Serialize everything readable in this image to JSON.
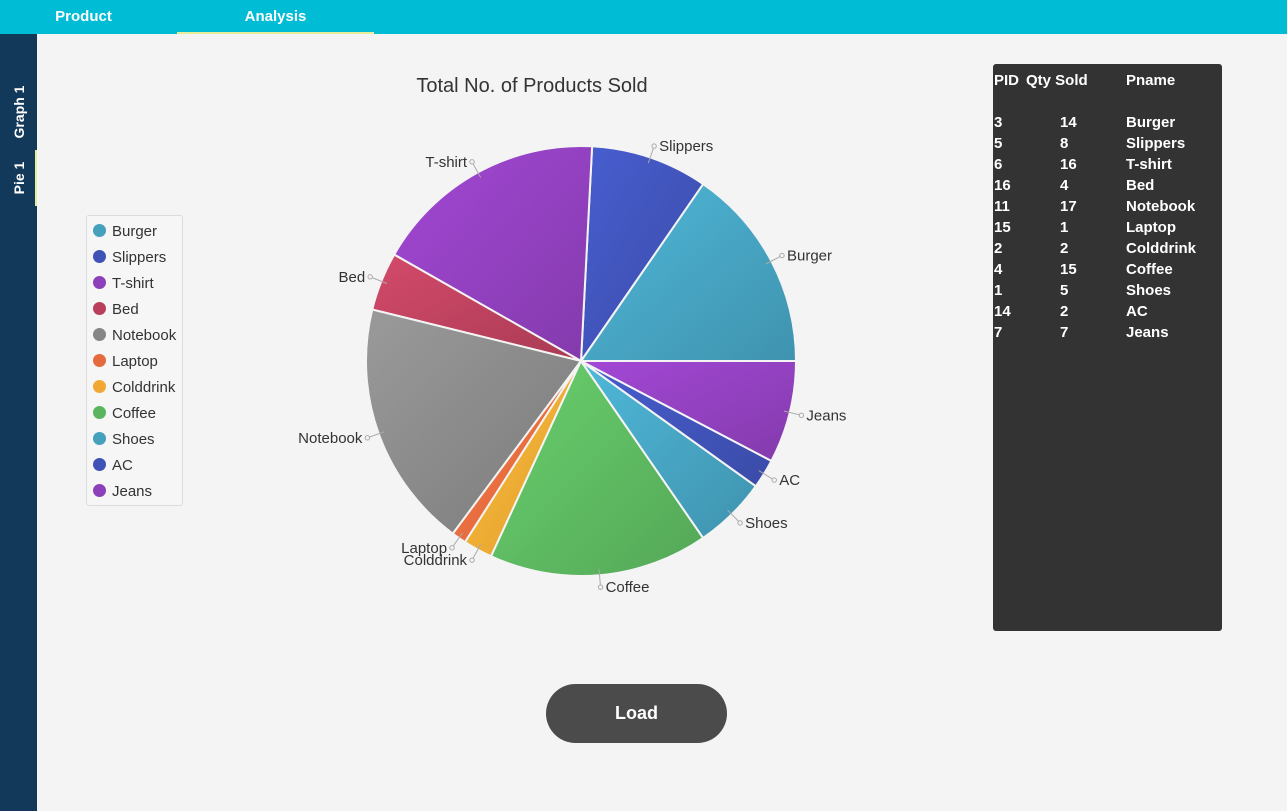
{
  "top_tabs": [
    {
      "label": "Product",
      "active": false
    },
    {
      "label": "Analysis",
      "active": true
    }
  ],
  "side_tabs": [
    {
      "label": "Graph 1",
      "active": false
    },
    {
      "label": "Pie 1",
      "active": true
    }
  ],
  "colors": {
    "topbar": "#00bcd4",
    "sidebar": "#13395a",
    "tab_indicator": "#e6ee9c",
    "panel": "#333333",
    "button": "#4b4b4b"
  },
  "chart_data": {
    "type": "pie",
    "title": "Total No. of Products Sold",
    "start_angle_deg": 0,
    "direction": "counterclockwise",
    "slices": [
      {
        "label": "Burger",
        "value": 14,
        "color": "#45a0bd"
      },
      {
        "label": "Slippers",
        "value": 8,
        "color": "#3f52b5"
      },
      {
        "label": "T-shirt",
        "value": 16,
        "color": "#8e3fba"
      },
      {
        "label": "Bed",
        "value": 4,
        "color": "#b8405c"
      },
      {
        "label": "Notebook",
        "value": 17,
        "color": "#868686"
      },
      {
        "label": "Laptop",
        "value": 1,
        "color": "#e56a3e"
      },
      {
        "label": "Colddrink",
        "value": 2,
        "color": "#f0a833"
      },
      {
        "label": "Coffee",
        "value": 15,
        "color": "#5bb55f"
      },
      {
        "label": "Shoes",
        "value": 5,
        "color": "#45a0bd"
      },
      {
        "label": "AC",
        "value": 2,
        "color": "#3f52b5"
      },
      {
        "label": "Jeans",
        "value": 7,
        "color": "#8e3fba"
      }
    ],
    "legend_position": "left"
  },
  "table": {
    "headers": [
      "PID",
      "Qty Sold",
      "Pname"
    ],
    "rows": [
      [
        "3",
        "14",
        "Burger"
      ],
      [
        "5",
        "8",
        "Slippers"
      ],
      [
        "6",
        "16",
        "T-shirt"
      ],
      [
        "16",
        "4",
        "Bed"
      ],
      [
        "11",
        "17",
        "Notebook"
      ],
      [
        "15",
        "1",
        "Laptop"
      ],
      [
        "2",
        "2",
        "Colddrink"
      ],
      [
        "4",
        "15",
        "Coffee"
      ],
      [
        "1",
        "5",
        "Shoes"
      ],
      [
        "14",
        "2",
        "AC"
      ],
      [
        "7",
        "7",
        "Jeans"
      ]
    ]
  },
  "load_button": {
    "label": "Load"
  }
}
